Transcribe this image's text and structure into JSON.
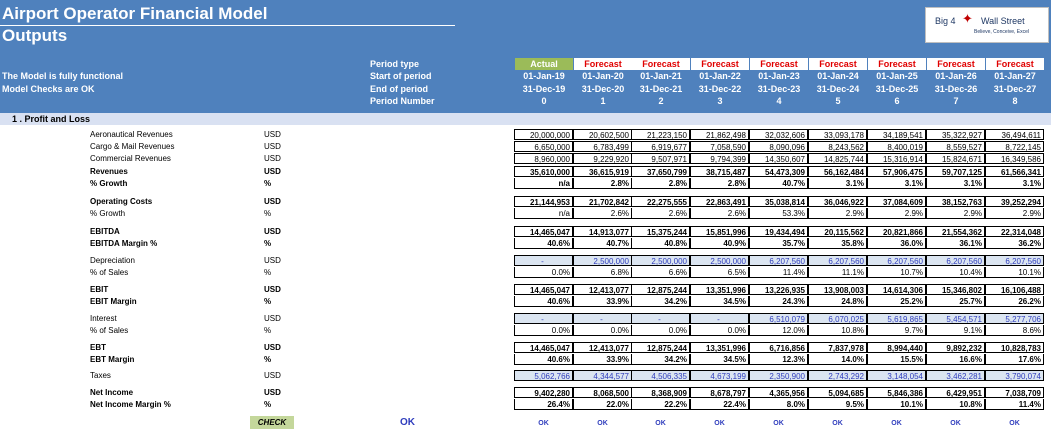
{
  "title": "Airport Operator Financial Model",
  "subtitle": "Outputs",
  "logo": {
    "left": "Big 4",
    "right": "Wall Street",
    "tagline": "Believe, Conceive, Excel"
  },
  "status_messages": [
    "The Model is fully functional",
    "Model Checks are OK"
  ],
  "period_labels": [
    "Period type",
    "Start of period",
    "End of period",
    "Period Number"
  ],
  "periods": [
    {
      "type": "Actual",
      "start": "01-Jan-19",
      "end": "31-Dec-19",
      "num": "0"
    },
    {
      "type": "Forecast",
      "start": "01-Jan-20",
      "end": "31-Dec-20",
      "num": "1"
    },
    {
      "type": "Forecast",
      "start": "01-Jan-21",
      "end": "31-Dec-21",
      "num": "2"
    },
    {
      "type": "Forecast",
      "start": "01-Jan-22",
      "end": "31-Dec-22",
      "num": "3"
    },
    {
      "type": "Forecast",
      "start": "01-Jan-23",
      "end": "31-Dec-23",
      "num": "4"
    },
    {
      "type": "Forecast",
      "start": "01-Jan-24",
      "end": "31-Dec-24",
      "num": "5"
    },
    {
      "type": "Forecast",
      "start": "01-Jan-25",
      "end": "31-Dec-25",
      "num": "6"
    },
    {
      "type": "Forecast",
      "start": "01-Jan-26",
      "end": "31-Dec-26",
      "num": "7"
    },
    {
      "type": "Forecast",
      "start": "01-Jan-27",
      "end": "31-Dec-27",
      "num": "8"
    }
  ],
  "section_title": "1 .  Profit and Loss",
  "rows": [
    {
      "label": "Aeronautical Revenues",
      "unit": "USD",
      "bold": false,
      "style": "box",
      "values": [
        "20,000,000",
        "20,602,500",
        "21,223,150",
        "21,862,498",
        "32,032,606",
        "33,093,178",
        "34,189,541",
        "35,322,927",
        "36,494,611"
      ]
    },
    {
      "label": "Cargo & Mail Revenues",
      "unit": "USD",
      "bold": false,
      "style": "box",
      "values": [
        "6,650,000",
        "6,783,499",
        "6,919,677",
        "7,058,590",
        "8,090,096",
        "8,243,562",
        "8,400,019",
        "8,559,527",
        "8,722,145"
      ]
    },
    {
      "label": "Commercial Revenues",
      "unit": "USD",
      "bold": false,
      "style": "box",
      "values": [
        "8,960,000",
        "9,229,920",
        "9,507,971",
        "9,794,399",
        "14,350,607",
        "14,825,744",
        "15,316,914",
        "15,824,671",
        "16,349,586"
      ]
    },
    {
      "label": "Revenues",
      "unit": "USD",
      "bold": true,
      "style": "box",
      "values": [
        "35,610,000",
        "36,615,919",
        "37,650,799",
        "38,715,487",
        "54,473,309",
        "56,162,484",
        "57,906,475",
        "59,707,125",
        "61,566,341"
      ]
    },
    {
      "label": "% Growth",
      "unit": "%",
      "bold": true,
      "style": "pct",
      "values": [
        "n/a",
        "2.8%",
        "2.8%",
        "2.8%",
        "40.7%",
        "3.1%",
        "3.1%",
        "3.1%",
        "3.1%"
      ]
    },
    {
      "label": "Operating Costs",
      "unit": "USD",
      "bold": true,
      "style": "box",
      "values": [
        "21,144,953",
        "21,702,842",
        "22,275,555",
        "22,863,491",
        "35,038,814",
        "36,046,922",
        "37,084,609",
        "38,152,763",
        "39,252,294"
      ]
    },
    {
      "label": "% Growth",
      "unit": "%",
      "bold": false,
      "style": "pct",
      "values": [
        "n/a",
        "2.6%",
        "2.6%",
        "2.6%",
        "53.3%",
        "2.9%",
        "2.9%",
        "2.9%",
        "2.9%"
      ]
    },
    {
      "label": "EBITDA",
      "unit": "USD",
      "bold": true,
      "style": "box",
      "values": [
        "14,465,047",
        "14,913,077",
        "15,375,244",
        "15,851,996",
        "19,434,494",
        "20,115,562",
        "20,821,866",
        "21,554,362",
        "22,314,048"
      ]
    },
    {
      "label": "EBITDA Margin %",
      "unit": "%",
      "bold": true,
      "style": "pct",
      "values": [
        "40.6%",
        "40.7%",
        "40.8%",
        "40.9%",
        "35.7%",
        "35.8%",
        "36.0%",
        "36.1%",
        "36.2%"
      ]
    },
    {
      "label": "Depreciation",
      "unit": "USD",
      "bold": false,
      "style": "blue",
      "values": [
        "-",
        "2,500,000",
        "2,500,000",
        "2,500,000",
        "6,207,560",
        "6,207,560",
        "6,207,560",
        "6,207,560",
        "6,207,560"
      ]
    },
    {
      "label": "% of Sales",
      "unit": "%",
      "bold": false,
      "style": "pct",
      "values": [
        "0.0%",
        "6.8%",
        "6.6%",
        "6.5%",
        "11.4%",
        "11.1%",
        "10.7%",
        "10.4%",
        "10.1%"
      ]
    },
    {
      "label": "EBIT",
      "unit": "USD",
      "bold": true,
      "style": "box",
      "values": [
        "14,465,047",
        "12,413,077",
        "12,875,244",
        "13,351,996",
        "13,226,935",
        "13,908,003",
        "14,614,306",
        "15,346,802",
        "16,106,488"
      ]
    },
    {
      "label": "EBIT Margin",
      "unit": "%",
      "bold": true,
      "style": "pct",
      "values": [
        "40.6%",
        "33.9%",
        "34.2%",
        "34.5%",
        "24.3%",
        "24.8%",
        "25.2%",
        "25.7%",
        "26.2%"
      ]
    },
    {
      "label": "Interest",
      "unit": "USD",
      "bold": false,
      "style": "blue",
      "values": [
        "-",
        "-",
        "-",
        "-",
        "6,510,079",
        "6,070,025",
        "5,619,865",
        "5,454,571",
        "5,277,706"
      ]
    },
    {
      "label": "% of Sales",
      "unit": "%",
      "bold": false,
      "style": "pct",
      "values": [
        "0.0%",
        "0.0%",
        "0.0%",
        "0.0%",
        "12.0%",
        "10.8%",
        "9.7%",
        "9.1%",
        "8.6%"
      ]
    },
    {
      "label": "EBT",
      "unit": "USD",
      "bold": true,
      "style": "box",
      "values": [
        "14,465,047",
        "12,413,077",
        "12,875,244",
        "13,351,996",
        "6,716,856",
        "7,837,978",
        "8,994,440",
        "9,892,232",
        "10,828,783"
      ]
    },
    {
      "label": "EBT Margin",
      "unit": "%",
      "bold": true,
      "style": "pct",
      "values": [
        "40.6%",
        "33.9%",
        "34.2%",
        "34.5%",
        "12.3%",
        "14.0%",
        "15.5%",
        "16.6%",
        "17.6%"
      ]
    },
    {
      "label": "Taxes",
      "unit": "USD",
      "bold": false,
      "style": "blue",
      "values": [
        "5,062,766",
        "4,344,577",
        "4,506,335",
        "4,673,199",
        "2,350,900",
        "2,743,292",
        "3,148,054",
        "3,462,281",
        "3,790,074"
      ]
    },
    {
      "label": "Net Income",
      "unit": "USD",
      "bold": true,
      "style": "box",
      "values": [
        "9,402,280",
        "8,068,500",
        "8,368,909",
        "8,678,797",
        "4,365,956",
        "5,094,685",
        "5,846,386",
        "6,429,951",
        "7,038,709"
      ]
    },
    {
      "label": "Net Income Margin %",
      "unit": "%",
      "bold": true,
      "style": "pct",
      "values": [
        "26.4%",
        "22.0%",
        "22.2%",
        "22.4%",
        "8.0%",
        "9.5%",
        "10.1%",
        "10.8%",
        "11.4%"
      ]
    }
  ],
  "check_label": "CHECK",
  "check_status": "OK",
  "column_checks": [
    "OK",
    "OK",
    "OK",
    "OK",
    "OK",
    "OK",
    "OK",
    "OK",
    "OK"
  ]
}
